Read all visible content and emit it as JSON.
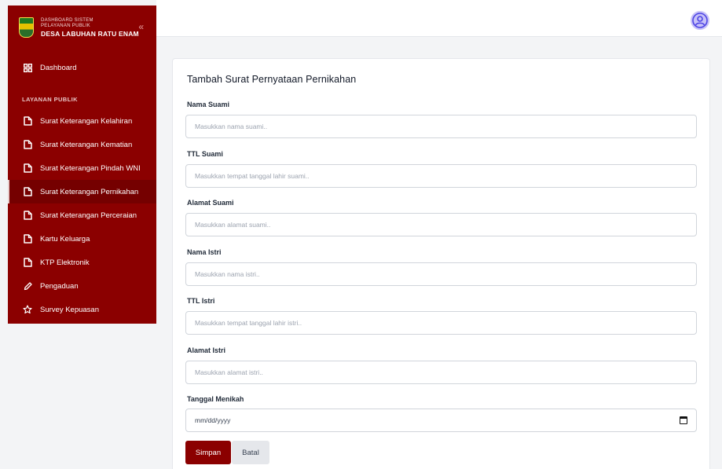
{
  "sidebar": {
    "brand_sub": "DASHBOARD SISTEM PELAYANAN PUBLIK",
    "brand_title": "DESA LABUHAN RATU ENAM",
    "collapse_glyph": "«",
    "dashboard_label": "Dashboard",
    "section_label": "LAYANAN PUBLIK",
    "items": [
      {
        "label": "Surat Keterangan Kelahiran",
        "icon": "file-icon"
      },
      {
        "label": "Surat Keterangan Kematian",
        "icon": "file-icon"
      },
      {
        "label": "Surat Keterangan Pindah WNI",
        "icon": "file-icon"
      },
      {
        "label": "Surat Keterangan Pernikahan",
        "icon": "file-icon",
        "active": true
      },
      {
        "label": "Surat Keterangan Perceraian",
        "icon": "file-icon"
      },
      {
        "label": "Kartu Keluarga",
        "icon": "file-icon"
      },
      {
        "label": "KTP Elektronik",
        "icon": "file-icon"
      },
      {
        "label": "Pengaduan",
        "icon": "pencil-icon"
      },
      {
        "label": "Survey Kepuasan",
        "icon": "star-icon"
      }
    ]
  },
  "form": {
    "title": "Tambah Surat Pernyataan Pernikahan",
    "fields": [
      {
        "label": "Nama Suami",
        "placeholder": "Masukkan nama suami.."
      },
      {
        "label": "TTL Suami",
        "placeholder": "Masukkan tempat tanggal lahir suami.."
      },
      {
        "label": "Alamat Suami",
        "placeholder": "Masukkan alamat suami.."
      },
      {
        "label": "Nama Istri",
        "placeholder": "Masukkan nama istri.."
      },
      {
        "label": "TTL Istri",
        "placeholder": "Masukkan tempat tanggal lahir istri.."
      },
      {
        "label": "Alamat Istri",
        "placeholder": "Masukkan alamat istri.."
      }
    ],
    "date_label": "Tanggal Menikah",
    "date_value": "mm/dd/yyyy",
    "save_label": "Simpan",
    "cancel_label": "Batal"
  },
  "colors": {
    "primary": "#8b0000",
    "active_item": "#750000",
    "avatar": "#c7c2f7"
  }
}
